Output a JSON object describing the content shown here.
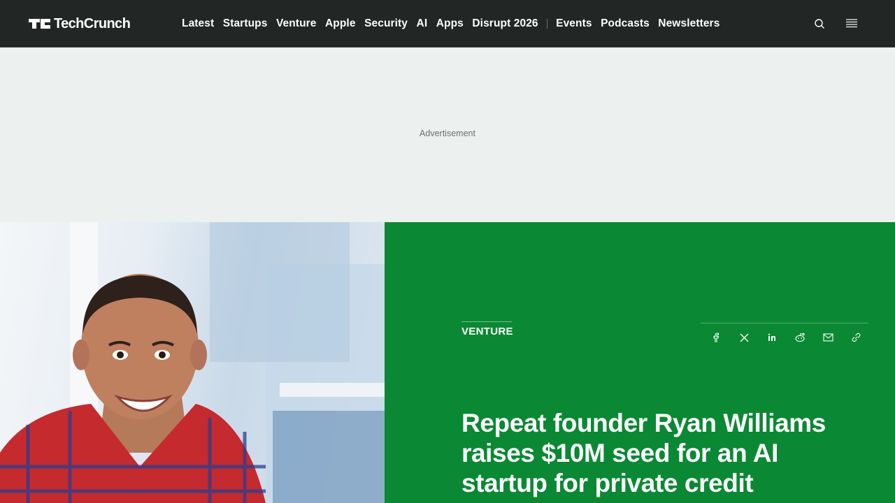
{
  "header": {
    "logo_text": "TechCrunch",
    "nav_items": [
      "Latest",
      "Startups",
      "Venture",
      "Apple",
      "Security",
      "AI",
      "Apps",
      "Disrupt 2026"
    ],
    "nav_secondary": [
      "Events",
      "Podcasts",
      "Newsletters"
    ],
    "icons": [
      "search-icon",
      "menu-icon"
    ]
  },
  "ad": {
    "label": "Advertisement"
  },
  "article": {
    "category": "VENTURE",
    "headline": "Repeat founder Ryan Williams raises $10M seed for an AI startup for private credit",
    "share_icons": [
      "facebook-icon",
      "x-icon",
      "linkedin-icon",
      "reddit-icon",
      "email-icon",
      "link-icon"
    ]
  },
  "colors": {
    "header_bg": "#222624",
    "ad_bg": "#ecf0ee",
    "hero_panel": "#0b8833",
    "text_light": "#ffffff"
  }
}
